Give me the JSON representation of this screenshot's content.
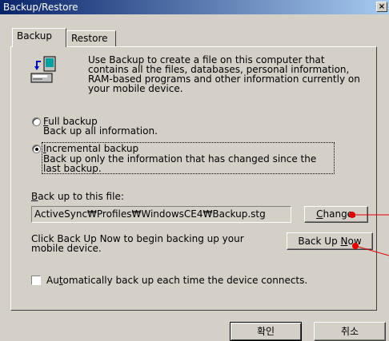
{
  "window": {
    "title": "Backup/Restore",
    "close_glyph": "×"
  },
  "tabs": [
    {
      "label": "Backup",
      "active": true
    },
    {
      "label": "Restore",
      "active": false
    }
  ],
  "backup": {
    "icon": "backup-icon",
    "description_lines": [
      "Use Backup to create a file on this computer that",
      "contains all the files, databases, personal information,",
      "RAM-based programs and other information currently on",
      "your mobile device."
    ],
    "full": {
      "title_accel": "F",
      "title_rest": "ull backup",
      "desc": "Back up all information.",
      "selected": false
    },
    "incremental": {
      "title_accel": "I",
      "title_rest": "ncremental backup",
      "desc_line1": "Back up only the information that has changed since the",
      "desc_line2": "last backup.",
      "selected": true
    },
    "file_label_accel": "B",
    "file_label_rest": "ack up to this file:",
    "file_path": "ActiveSync₩Profiles₩WindowsCE4₩Backup.stg",
    "change_button_accel": "C",
    "change_button_rest": "hange.",
    "now_text_line1": "Click Back Up Now to begin backing up your",
    "now_text_line2": "mobile device.",
    "now_button_pre": "Back Up ",
    "now_button_accel": "N",
    "now_button_post": "ow",
    "auto_label_pre": "Au",
    "auto_label_accel": "t",
    "auto_label_post": "omatically back up each time the device connects.",
    "auto_checked": false
  },
  "footer": {
    "ok_label": "확인",
    "cancel_label": "취소"
  },
  "colors": {
    "face": "#d4d0c8",
    "titlebar": "#0a246a",
    "annotation": "#e00000"
  }
}
